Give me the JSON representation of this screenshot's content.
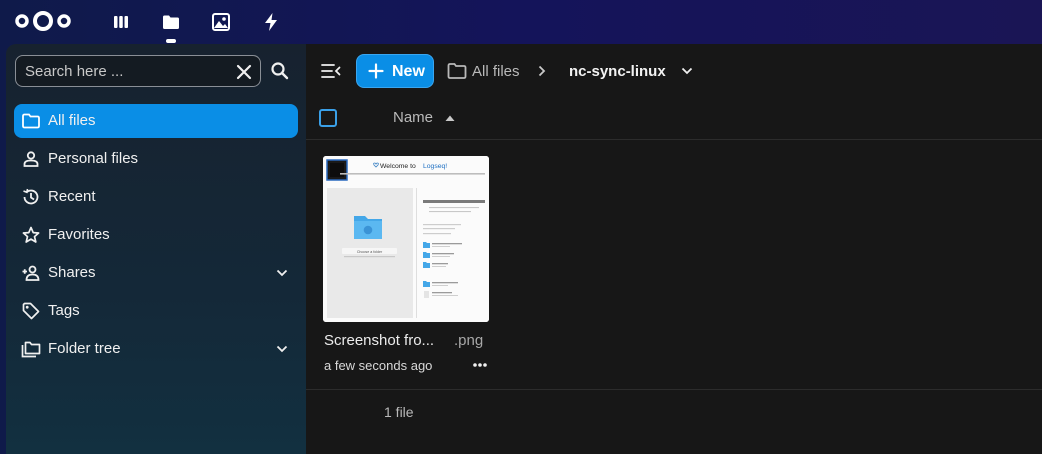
{
  "colors": {
    "accent": "#0a8ee6",
    "header_bg": "#14145a",
    "sidebar_bg": "#17222f",
    "main_bg": "#171717"
  },
  "topbar": {
    "logo": "nextcloud-logo",
    "apps": [
      {
        "name": "dashboard-icon"
      },
      {
        "name": "files-icon",
        "active": true
      },
      {
        "name": "photos-icon"
      },
      {
        "name": "activity-icon"
      }
    ]
  },
  "search": {
    "placeholder": "Search here ..."
  },
  "sidebar": {
    "items": [
      {
        "label": "All files",
        "icon": "folder-icon",
        "active": true
      },
      {
        "label": "Personal files",
        "icon": "person-icon"
      },
      {
        "label": "Recent",
        "icon": "history-icon"
      },
      {
        "label": "Favorites",
        "icon": "star-icon"
      },
      {
        "label": "Shares",
        "icon": "share-icon",
        "expandable": true
      },
      {
        "label": "Tags",
        "icon": "tag-icon"
      },
      {
        "label": "Folder tree",
        "icon": "folder-tree-icon",
        "expandable": true
      }
    ]
  },
  "toolbar": {
    "new_label": "New",
    "breadcrumb_root": "All files",
    "breadcrumb_current": "nc-sync-linux"
  },
  "list_header": {
    "name_label": "Name",
    "sort": "ascending"
  },
  "files": [
    {
      "name": "Screenshot fro...",
      "extension": ".png",
      "modified": "a few seconds ago",
      "thumbnail_text": {
        "title": "Welcome to",
        "brand": "Logseq!",
        "choose_folder": "Choose a folder"
      }
    }
  ],
  "footer": {
    "count_label": "1 file"
  }
}
